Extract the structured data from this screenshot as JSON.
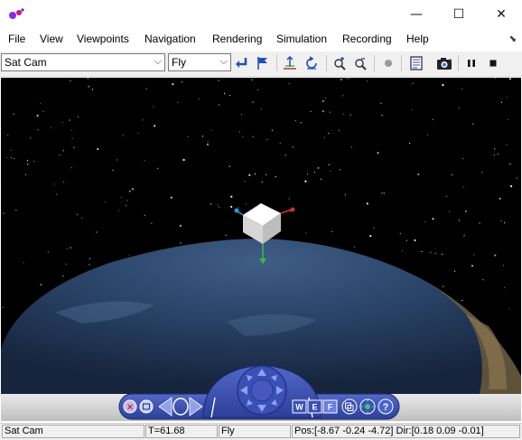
{
  "window": {
    "minimize_glyph": "—",
    "maximize_glyph": "☐",
    "close_glyph": "✕"
  },
  "menu": [
    "File",
    "View",
    "Viewpoints",
    "Navigation",
    "Rendering",
    "Simulation",
    "Recording",
    "Help"
  ],
  "toolbar": {
    "viewpoint_value": "Sat Cam",
    "nav_mode_value": "Fly",
    "dropdown_glyph": "⌵"
  },
  "navigation_panel": {
    "buttons": [
      "W",
      "E",
      "F"
    ],
    "help_glyph": "?"
  },
  "status": {
    "viewpoint": "Sat Cam",
    "time": "T=61.68",
    "mode": "Fly",
    "position": "Pos:[-8.67 -0.24 -4.72] Dir:[0.18 0.09 -0.01]"
  },
  "colors": {
    "toolbar_icon_blue": "#1f4fbf",
    "nav_panel_blue": "#3a4fb0",
    "sky": "#000000"
  }
}
